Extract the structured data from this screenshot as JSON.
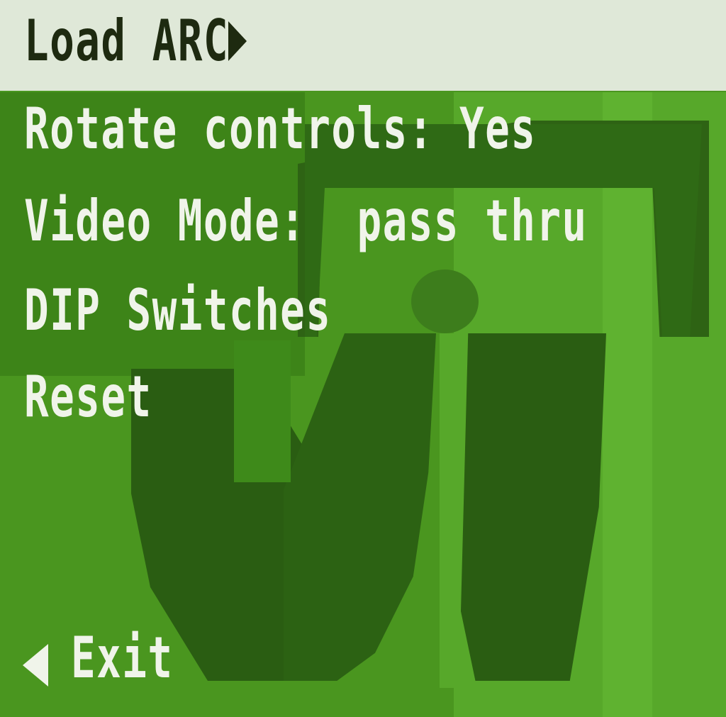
{
  "menu": {
    "title": "Load ARC",
    "items": [
      {
        "label": "Rotate controls: Yes"
      },
      {
        "label": "Video Mode:  pass thru"
      },
      {
        "label": "DIP Switches"
      },
      {
        "label": "Reset"
      }
    ],
    "exit_label": "Exit"
  },
  "icons": {
    "title_submenu_arrow": "right-triangle-icon",
    "exit_back_arrow": "left-triangle-icon"
  },
  "colors": {
    "title_bar": "#dfe8d8",
    "title_text": "#1e2a10",
    "background": "#4a961f",
    "menu_text": "#f0f4ea"
  }
}
